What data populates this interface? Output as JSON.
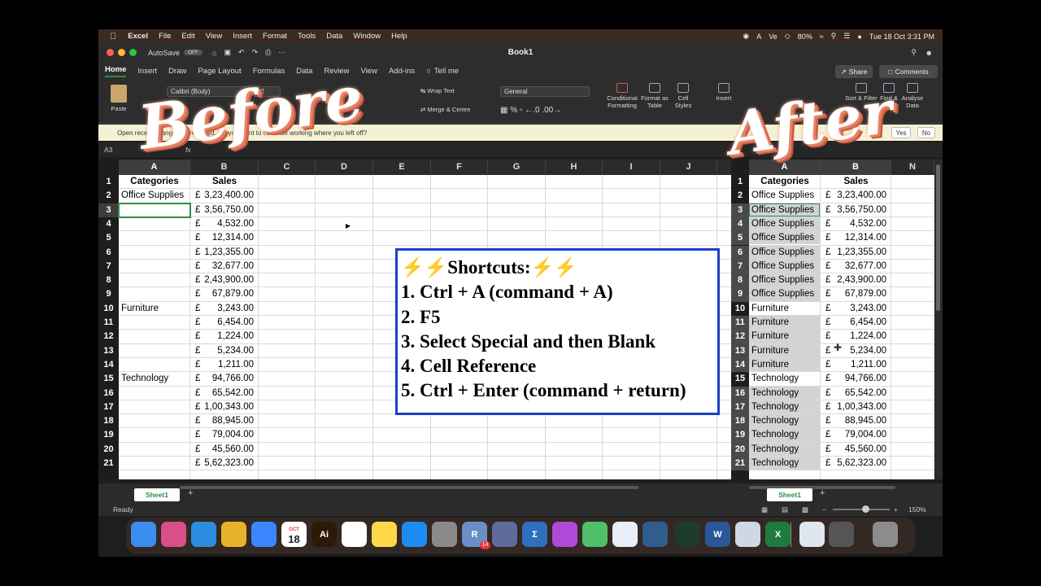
{
  "menubar": {
    "apple": "",
    "items": [
      "Excel",
      "File",
      "Edit",
      "View",
      "Insert",
      "Format",
      "Tools",
      "Data",
      "Window",
      "Help"
    ],
    "battery": "80%",
    "datetime": "Tue 18 Oct  3:31 PM"
  },
  "window": {
    "title": "Book1",
    "autosave_label": "AutoSave",
    "autosave_state": "OFF"
  },
  "ribbon_tabs": [
    "Home",
    "Insert",
    "Draw",
    "Page Layout",
    "Formulas",
    "Data",
    "Review",
    "View",
    "Add-ins"
  ],
  "tell_me": "Tell me",
  "share_label": "Share",
  "comments_label": "Comments",
  "ribbon": {
    "paste": "Paste",
    "font_name": "Calibri (Body)",
    "font_size": "12",
    "wrap_text": "Wrap Text",
    "merge_centre": "Merge & Centre",
    "number_format": "General",
    "conditional_formatting": "Conditional Formatting",
    "format_as_table": "Format as Table",
    "cell_styles": "Cell Styles",
    "insert": "Insert",
    "sort_filter": "Sort & Filter",
    "find_select": "Find & Select",
    "analyse_data": "Analyse Data"
  },
  "notification": {
    "text": "Open recent changes were saved. Do you want to continue working where you left off?",
    "yes": "Yes",
    "no": "No"
  },
  "name_box": "A3",
  "overlay": {
    "before": "Before",
    "after": "After"
  },
  "left_grid": {
    "columns": [
      "A",
      "B",
      "C",
      "D",
      "E",
      "F",
      "G",
      "H",
      "I",
      "J"
    ],
    "header_row": {
      "a": "Categories",
      "b": "Sales"
    },
    "rows": [
      {
        "n": "2",
        "a": "Office Supplies",
        "cur": "£",
        "amt": "3,23,400.00"
      },
      {
        "n": "3",
        "a": "",
        "cur": "£",
        "amt": "3,56,750.00"
      },
      {
        "n": "4",
        "a": "",
        "cur": "£",
        "amt": "4,532.00"
      },
      {
        "n": "5",
        "a": "",
        "cur": "£",
        "amt": "12,314.00"
      },
      {
        "n": "6",
        "a": "",
        "cur": "£",
        "amt": "1,23,355.00"
      },
      {
        "n": "7",
        "a": "",
        "cur": "£",
        "amt": "32,677.00"
      },
      {
        "n": "8",
        "a": "",
        "cur": "£",
        "amt": "2,43,900.00"
      },
      {
        "n": "9",
        "a": "",
        "cur": "£",
        "amt": "67,879.00"
      },
      {
        "n": "10",
        "a": "Furniture",
        "cur": "£",
        "amt": "3,243.00"
      },
      {
        "n": "11",
        "a": "",
        "cur": "£",
        "amt": "6,454.00"
      },
      {
        "n": "12",
        "a": "",
        "cur": "£",
        "amt": "1,224.00"
      },
      {
        "n": "13",
        "a": "",
        "cur": "£",
        "amt": "5,234.00"
      },
      {
        "n": "14",
        "a": "",
        "cur": "£",
        "amt": "1,211.00"
      },
      {
        "n": "15",
        "a": "Technology",
        "cur": "£",
        "amt": "94,766.00"
      },
      {
        "n": "16",
        "a": "",
        "cur": "£",
        "amt": "65,542.00"
      },
      {
        "n": "17",
        "a": "",
        "cur": "£",
        "amt": "1,00,343.00"
      },
      {
        "n": "18",
        "a": "",
        "cur": "£",
        "amt": "88,945.00"
      },
      {
        "n": "19",
        "a": "",
        "cur": "£",
        "amt": "79,004.00"
      },
      {
        "n": "20",
        "a": "",
        "cur": "£",
        "amt": "45,560.00"
      },
      {
        "n": "21",
        "a": "",
        "cur": "£",
        "amt": "5,62,323.00"
      }
    ]
  },
  "right_grid": {
    "columns": [
      "A",
      "B",
      "N"
    ],
    "header_row": {
      "a": "Categories",
      "b": "Sales"
    },
    "rows": [
      {
        "n": "2",
        "a": "Office Supplies",
        "cur": "£",
        "amt": "3,23,400.00",
        "filled": false
      },
      {
        "n": "3",
        "a": "Office Supplies",
        "cur": "£",
        "amt": "3,56,750.00",
        "filled": true
      },
      {
        "n": "4",
        "a": "Office Supplies",
        "cur": "£",
        "amt": "4,532.00",
        "filled": true
      },
      {
        "n": "5",
        "a": "Office Supplies",
        "cur": "£",
        "amt": "12,314.00",
        "filled": true
      },
      {
        "n": "6",
        "a": "Office Supplies",
        "cur": "£",
        "amt": "1,23,355.00",
        "filled": true
      },
      {
        "n": "7",
        "a": "Office Supplies",
        "cur": "£",
        "amt": "32,677.00",
        "filled": true
      },
      {
        "n": "8",
        "a": "Office Supplies",
        "cur": "£",
        "amt": "2,43,900.00",
        "filled": true
      },
      {
        "n": "9",
        "a": "Office Supplies",
        "cur": "£",
        "amt": "67,879.00",
        "filled": true
      },
      {
        "n": "10",
        "a": "Furniture",
        "cur": "£",
        "amt": "3,243.00",
        "filled": false
      },
      {
        "n": "11",
        "a": "Furniture",
        "cur": "£",
        "amt": "6,454.00",
        "filled": true
      },
      {
        "n": "12",
        "a": "Furniture",
        "cur": "£",
        "amt": "1,224.00",
        "filled": true
      },
      {
        "n": "13",
        "a": "Furniture",
        "cur": "£",
        "amt": "5,234.00",
        "filled": true
      },
      {
        "n": "14",
        "a": "Furniture",
        "cur": "£",
        "amt": "1,211.00",
        "filled": true
      },
      {
        "n": "15",
        "a": "Technology",
        "cur": "£",
        "amt": "94,766.00",
        "filled": false
      },
      {
        "n": "16",
        "a": "Technology",
        "cur": "£",
        "amt": "65,542.00",
        "filled": true
      },
      {
        "n": "17",
        "a": "Technology",
        "cur": "£",
        "amt": "1,00,343.00",
        "filled": true
      },
      {
        "n": "18",
        "a": "Technology",
        "cur": "£",
        "amt": "88,945.00",
        "filled": true
      },
      {
        "n": "19",
        "a": "Technology",
        "cur": "£",
        "amt": "79,004.00",
        "filled": true
      },
      {
        "n": "20",
        "a": "Technology",
        "cur": "£",
        "amt": "45,560.00",
        "filled": true
      },
      {
        "n": "21",
        "a": "Technology",
        "cur": "£",
        "amt": "5,62,323.00",
        "filled": true
      }
    ]
  },
  "shortcuts": {
    "title": "⚡⚡Shortcuts:⚡⚡",
    "lines": [
      "1. Ctrl + A (command + A)",
      "2. F5",
      "3. Select Special and then Blank",
      "4. Cell Reference",
      "5. Ctrl + Enter (command + return)"
    ]
  },
  "sheet_tab": "Sheet1",
  "status": {
    "ready": "Ready",
    "zoom": "150%"
  },
  "dock": {
    "calendar_month": "OCT",
    "calendar_day": "18",
    "badge": "14"
  },
  "colors": {
    "excel_green": "#2f8c4a",
    "shortcut_border": "#1a40c8",
    "filled_cell": "#d3d3d3",
    "overlay_shadow": "#e57a5a"
  }
}
